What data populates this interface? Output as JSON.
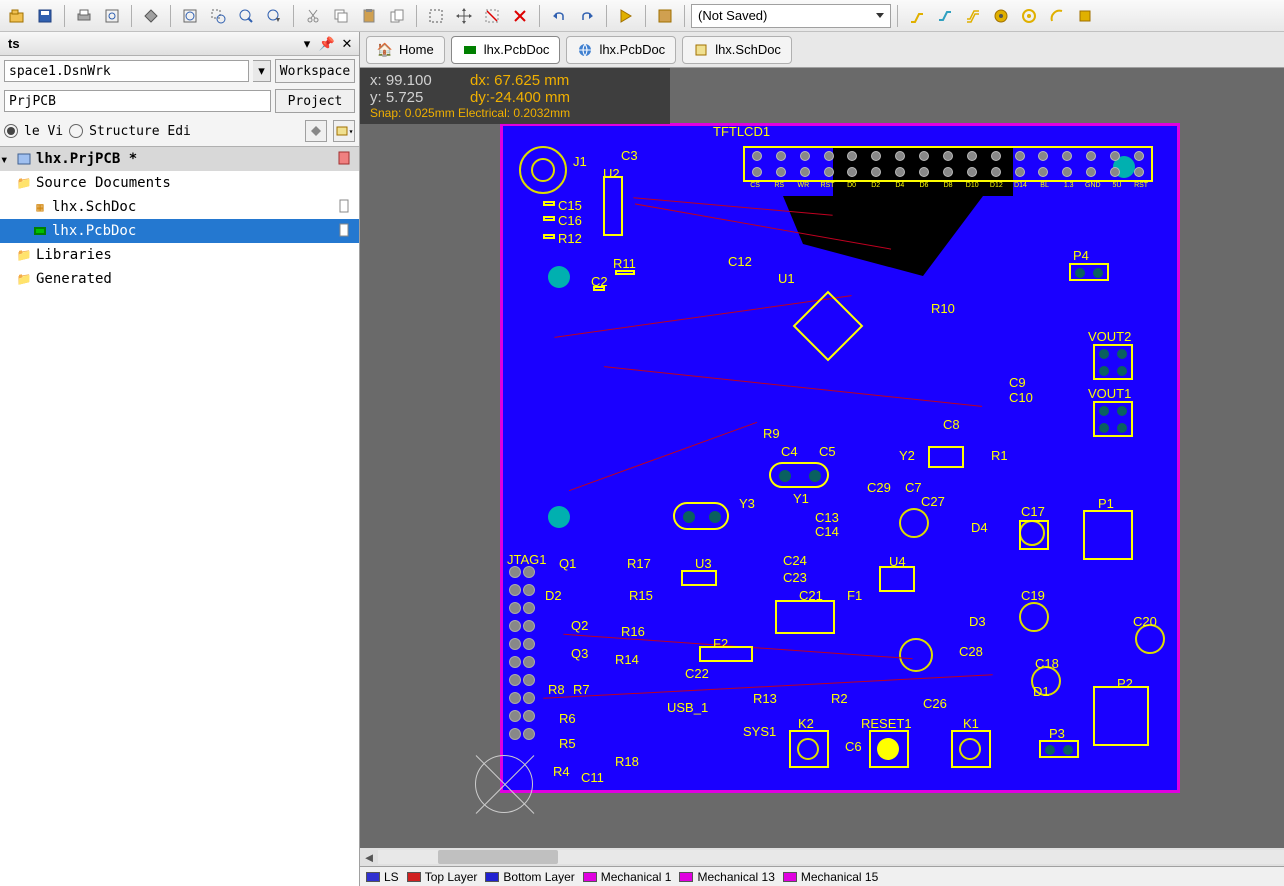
{
  "toolbar": {
    "combo_value": "(Not Saved)"
  },
  "panel": {
    "title": "ts",
    "workspace_value": "space1.DsnWrk",
    "workspace_btn": "Workspace",
    "project_value": "PrjPCB",
    "project_btn": "Project",
    "radio1": "le Vi",
    "radio2": "Structure Edi"
  },
  "tree": {
    "root": "lhx.PrjPCB *",
    "folder1": "Source Documents",
    "file1": "lhx.SchDoc",
    "file2": "lhx.PcbDoc",
    "folder2": "Libraries",
    "folder3": "Generated"
  },
  "tabs": {
    "home": "Home",
    "t1": "lhx.PcbDoc",
    "t2": "lhx.PcbDoc",
    "t3": "lhx.SchDoc"
  },
  "coords": {
    "x_label": "x: 99.100",
    "dx_label": "dx: 67.625 mm",
    "y_label": "y:  5.725",
    "dy_label": "dy:-24.400 mm",
    "snap": "Snap: 0.025mm Electrical: 0.2032mm"
  },
  "layers": {
    "ls": "LS",
    "top": "Top Layer",
    "bottom": "Bottom Layer",
    "mech1": "Mechanical 1",
    "mech13": "Mechanical 13",
    "mech15": "Mechanical 15"
  },
  "pcb": {
    "tft": "TFTLCD1",
    "j1": "J1",
    "c3": "C3",
    "u2": "U2",
    "c15": "C15",
    "c16": "C16",
    "r12": "R12",
    "r11": "R11",
    "c2": "C2",
    "c12": "C12",
    "u1": "U1",
    "r10": "R10",
    "p4": "P4",
    "c9": "C9",
    "c10": "C10",
    "vout2": "VOUT2",
    "vout1": "VOUT1",
    "r9": "R9",
    "c4": "C4",
    "c5": "C5",
    "y2": "Y2",
    "r1": "R1",
    "c8": "C8",
    "c29": "C29",
    "c7": "C7",
    "c27": "C27",
    "y3": "Y3",
    "y1": "Y1",
    "c13": "C13",
    "c14": "C14",
    "d4": "D4",
    "c17": "C17",
    "p1": "P1",
    "jtag1": "JTAG1",
    "q1": "Q1",
    "r17": "R17",
    "u3": "U3",
    "c24": "C24",
    "c23": "C23",
    "u4": "U4",
    "d2": "D2",
    "r15": "R15",
    "c21": "C21",
    "f1": "F1",
    "d3": "D3",
    "c19": "C19",
    "q2": "Q2",
    "r16": "R16",
    "f2": "F2",
    "c28": "C28",
    "c18": "C18",
    "c20": "C20",
    "q3": "Q3",
    "r14": "R14",
    "c22": "C22",
    "r8": "R8",
    "r7": "R7",
    "usb1": "USB_1",
    "r13": "R13",
    "r2": "R2",
    "c26": "C26",
    "d1": "D1",
    "p2": "P2",
    "r6": "R6",
    "sys1": "SYS1",
    "k2": "K2",
    "reset1": "RESET1",
    "k1": "K1",
    "c6": "C6",
    "r5": "R5",
    "r18": "R18",
    "p3": "P3",
    "r4": "R4",
    "c11": "C11"
  }
}
